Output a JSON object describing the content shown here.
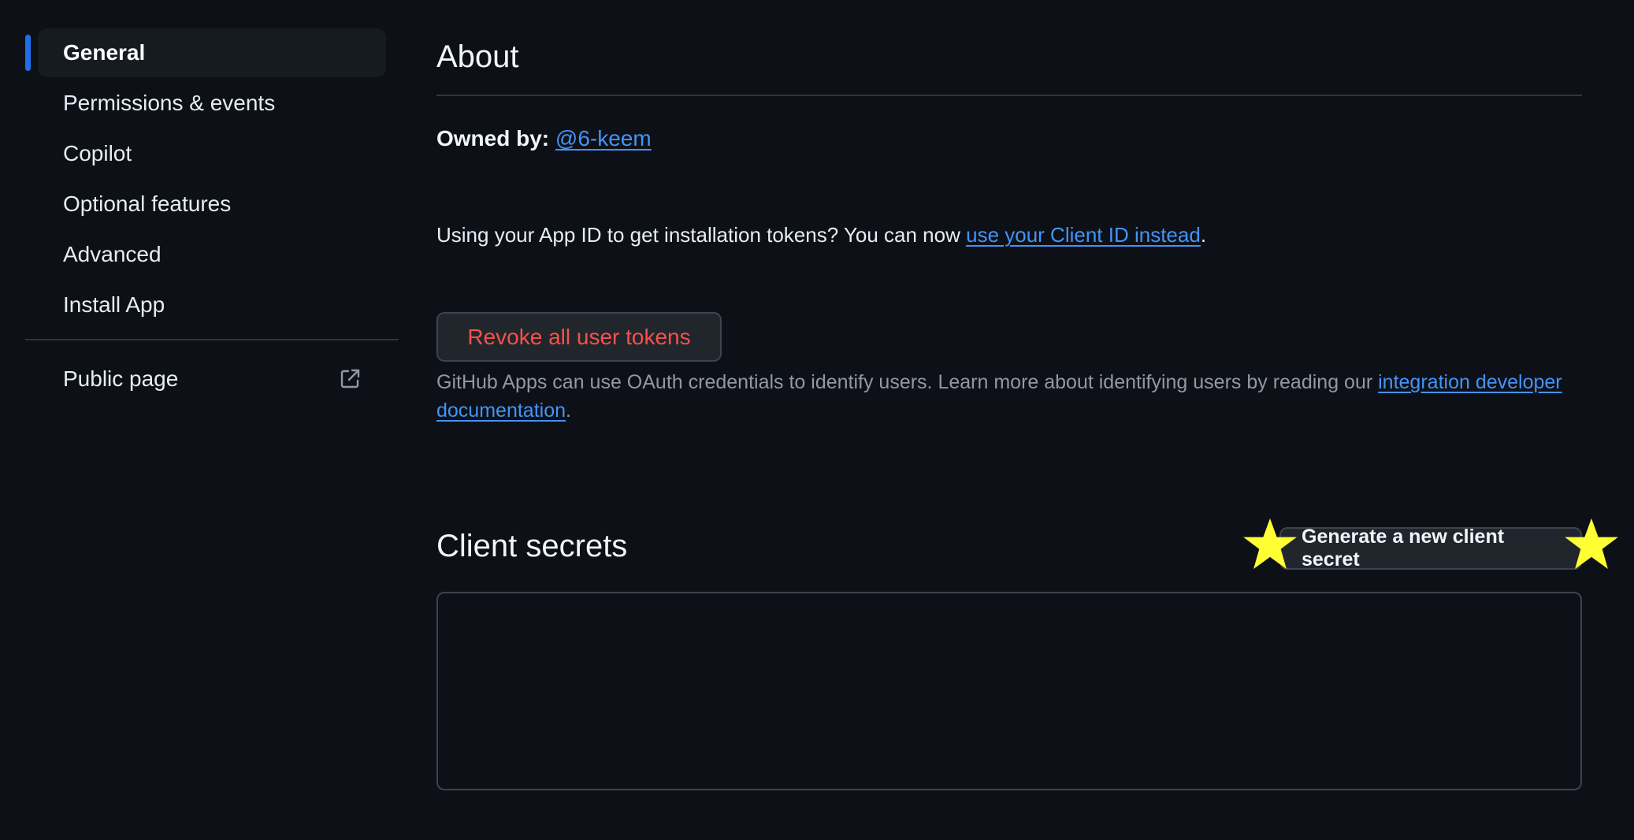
{
  "sidebar": {
    "items": [
      {
        "label": "General",
        "active": true
      },
      {
        "label": "Permissions & events"
      },
      {
        "label": "Copilot"
      },
      {
        "label": "Optional features"
      },
      {
        "label": "Advanced"
      },
      {
        "label": "Install App"
      }
    ],
    "public_page": {
      "label": "Public page",
      "icon": "external-link-icon"
    }
  },
  "about": {
    "title": "About",
    "owned_by_label": "Owned by:",
    "owner_link": "@6-keem",
    "appid_note_prefix": "Using your App ID to get installation tokens? You can now ",
    "appid_note_link": "use your Client ID instead",
    "appid_note_suffix": ".",
    "revoke_button": "Revoke all user tokens",
    "oauth_note_prefix": "GitHub Apps can use OAuth credentials to identify users. Learn more about identifying users by reading our ",
    "oauth_note_link": "integration developer documentation",
    "oauth_note_suffix": "."
  },
  "client_secrets": {
    "title": "Client secrets",
    "generate_button": "Generate a new client secret"
  },
  "colors": {
    "background": "#0d1117",
    "accent": "#1f6feb",
    "link": "#4493f8",
    "danger": "#f85149",
    "star": "#ffff33"
  }
}
